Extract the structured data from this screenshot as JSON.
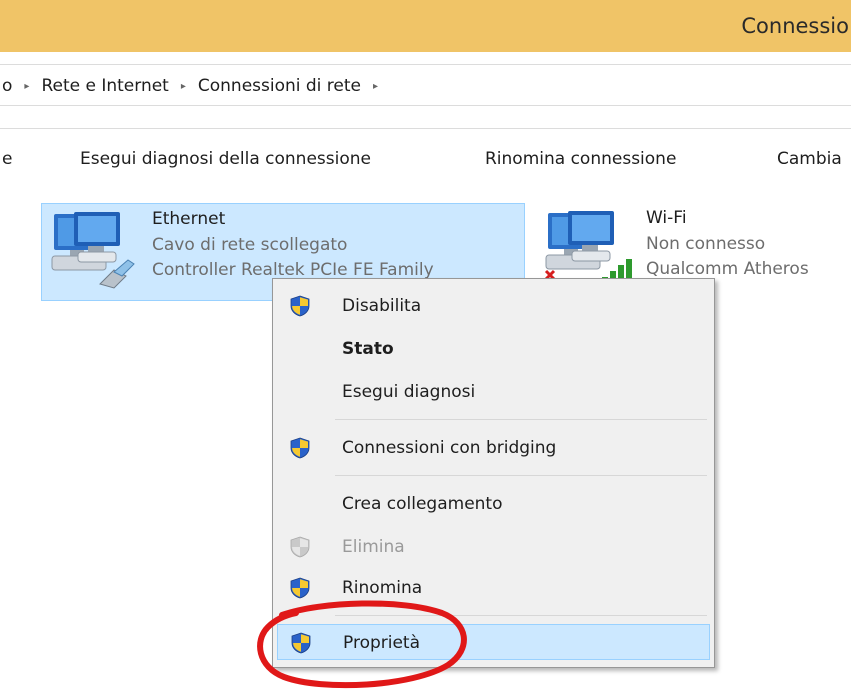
{
  "window": {
    "title": "Connessio"
  },
  "address": {
    "crumbs": [
      "o",
      "Rete e Internet",
      "Connessioni di rete",
      ""
    ],
    "separator": "▸"
  },
  "toolbar": {
    "items": [
      "e",
      "Esegui diagnosi della connessione",
      "Rinomina connessione",
      "Cambia"
    ]
  },
  "connections": [
    {
      "name": "Ethernet",
      "status": "Cavo di rete scollegato",
      "device": "Controller Realtek PCIe FE Family",
      "icon": "ethernet-adapter-icon",
      "selected": true
    },
    {
      "name": "Wi-Fi",
      "status": "Non connesso",
      "device": "Qualcomm Atheros",
      "icon": "wifi-adapter-icon",
      "selected": false
    }
  ],
  "context_menu": {
    "items": [
      {
        "label": "Disabilita",
        "shield": true,
        "enabled": true
      },
      {
        "label": "Stato",
        "bold": true,
        "enabled": true
      },
      {
        "label": "Esegui diagnosi",
        "enabled": true
      },
      {
        "label": "Connessioni con bridging",
        "shield": true,
        "enabled": true
      },
      {
        "label": "Crea collegamento",
        "enabled": true
      },
      {
        "label": "Elimina",
        "shield": true,
        "enabled": false
      },
      {
        "label": "Rinomina",
        "shield": true,
        "enabled": true
      },
      {
        "label": "Proprietà",
        "shield": true,
        "enabled": true,
        "highlighted": true
      }
    ]
  },
  "colors": {
    "titlebar": "#f0c467",
    "selection": "#cce8ff",
    "annotation": "#e01818",
    "shield_blue": "#2a62c9",
    "shield_yellow": "#f6c931"
  }
}
